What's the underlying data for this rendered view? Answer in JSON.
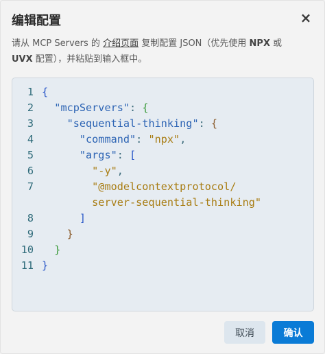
{
  "dialog": {
    "title": "编辑配置",
    "close_glyph": "×",
    "close_icon": "close-icon"
  },
  "description": {
    "part1": "请从 MCP Servers 的 ",
    "link": "介绍页面",
    "part2": " 复制配置 JSON（优先使用 ",
    "npx": "NPX",
    "part3": " 或",
    "uvx": "UVX",
    "part4": " 配置），并粘贴到输入框中。"
  },
  "editor": {
    "line_numbers": [
      "1",
      "2",
      "3",
      "4",
      "5",
      "6",
      "7",
      "",
      "8",
      "9",
      "10",
      "11"
    ],
    "tokens": {
      "open_brace": "{",
      "mcp_servers_key": "\"mcpServers\"",
      "colon": ": ",
      "seq_key": "\"sequential-thinking\"",
      "command_key": "\"command\"",
      "command_val": "\"npx\"",
      "comma": ",",
      "args_key": "\"args\"",
      "open_bracket": "[",
      "arg1": "\"-y\"",
      "arg2_part1": "\"@modelcontextprotocol/",
      "arg2_part2": "server-sequential-thinking\"",
      "close_bracket": "]",
      "close_brace": "}"
    }
  },
  "buttons": {
    "cancel": "取消",
    "confirm": "确认"
  },
  "colors": {
    "accent": "#0a7bd6",
    "editor_bg": "#e6ecf2",
    "key": "#2d64b4",
    "string": "#a87c12"
  }
}
